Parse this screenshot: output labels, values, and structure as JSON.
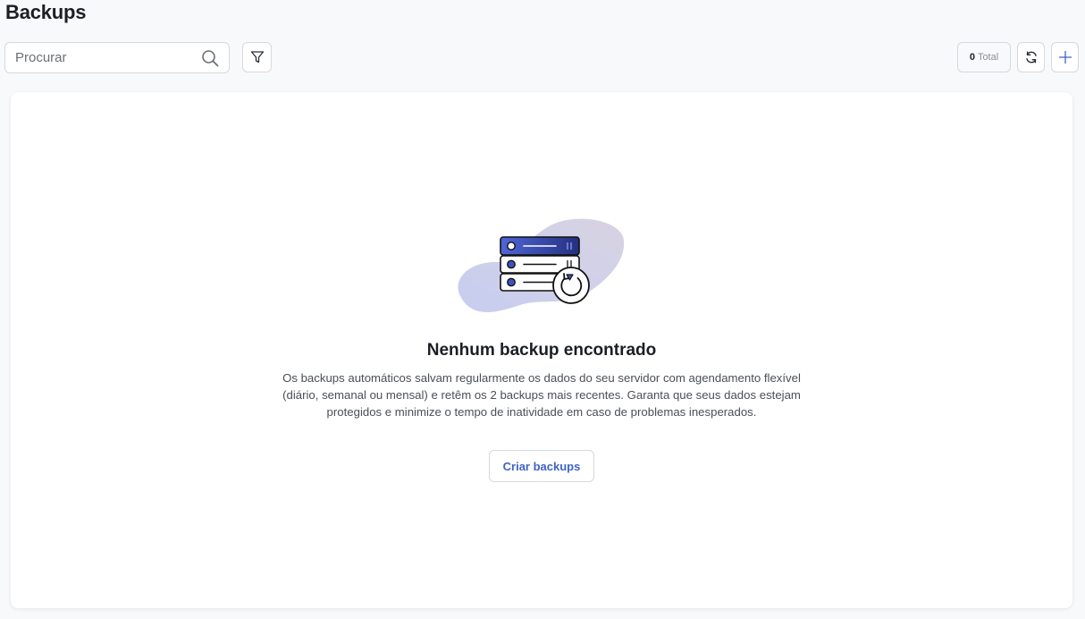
{
  "page": {
    "title": "Backups"
  },
  "toolbar": {
    "search_placeholder": "Procurar",
    "total_count": "0",
    "total_label": "Total"
  },
  "empty_state": {
    "title": "Nenhum backup encontrado",
    "description": "Os backups automáticos salvam regularmente os dados do seu servidor com agendamento flexível (diário, semanal ou mensal) e retêm os 2 backups mais recentes. Garanta que seus dados estejam protegidos e minimize o tempo de inatividade em caso de problemas inesperados.",
    "button_label": "Criar backups"
  },
  "colors": {
    "accent": "#3f63c8",
    "illustration_dark": "#2b3a9c",
    "illustration_blob": "#d4d2e4"
  },
  "icons": [
    "search-icon",
    "filter-icon",
    "refresh-icon",
    "plus-icon",
    "server-backup-illustration"
  ]
}
